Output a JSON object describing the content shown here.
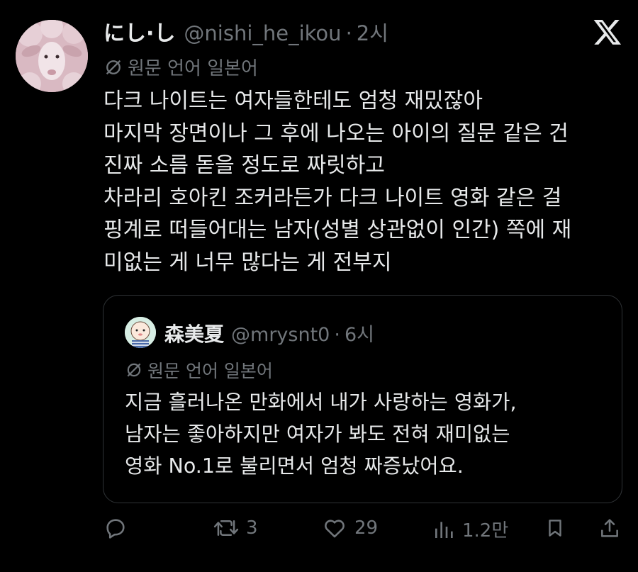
{
  "post": {
    "display_name": "にし·し",
    "handle": "@nishi_he_ikou",
    "separator": "·",
    "time": "2시",
    "translate_label": "원문 언어 일본어",
    "body_lines": [
      "다크 나이트는 여자들한테도 엄청 재밌잖아",
      "마지막 장면이나 그 후에 나오는 아이의 질문 같은 건",
      "진짜 소름 돋을 정도로 짜릿하고",
      "차라리 호아킨 조커라든가 다크 나이트 영화 같은 걸",
      "핑계로 떠들어대는 남자(성별 상관없이 인간) 쪽에 재",
      "미없는 게 너무 많다는 게 전부지"
    ]
  },
  "quote": {
    "display_name": "森美夏",
    "handle": "@mrysnt0",
    "separator": "·",
    "time": "6시",
    "translate_label": "원문 언어 일본어",
    "body_lines": [
      "지금 흘러나온 만화에서 내가 사랑하는 영화가,",
      "남자는 좋아하지만 여자가 봐도 전혀 재미없는",
      "영화 No.1로 불리면서 엄청 짜증났어요."
    ]
  },
  "actions": {
    "reply_icon": "reply-icon",
    "retweet_count": "3",
    "like_count": "29",
    "views_count": "1.2만",
    "bookmark_icon": "bookmark-icon",
    "share_icon": "share-icon"
  },
  "colors": {
    "background": "#000000",
    "text_primary": "#e7e9ea",
    "text_secondary": "#71767b",
    "border": "#2f3336"
  }
}
